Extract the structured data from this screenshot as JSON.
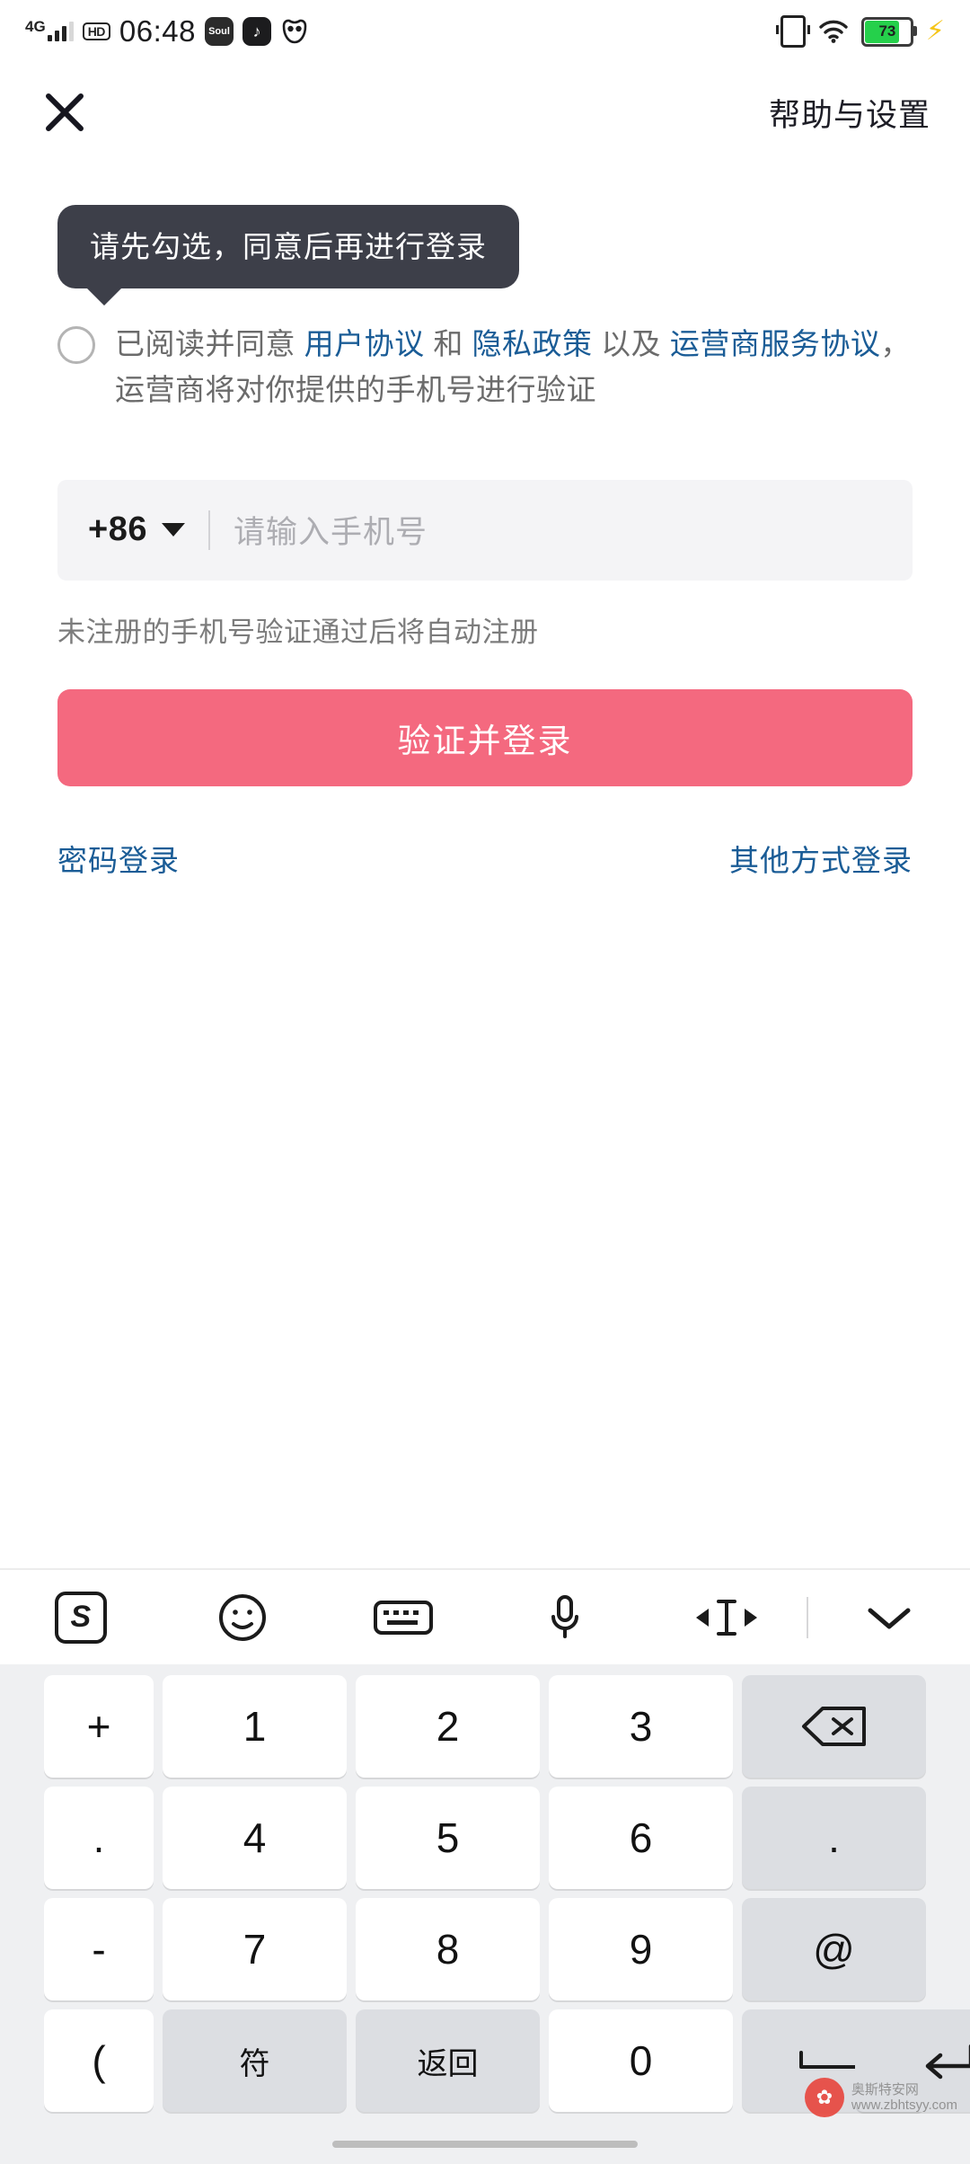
{
  "status_bar": {
    "network": "4G",
    "hd": "HD",
    "time": "06:48",
    "app_icons": [
      "Soul",
      "music-note",
      "owl"
    ],
    "battery_level": "73",
    "battery_color": "#25d04b"
  },
  "header": {
    "close_icon": "close-icon",
    "help_settings": "帮助与设置"
  },
  "tooltip": {
    "message": "请先勾选，同意后再进行登录"
  },
  "agreement": {
    "checked": false,
    "prefix": "已阅读并同意 ",
    "link_user": "用户协议",
    "conj1": " 和 ",
    "link_privacy": "隐私政策",
    "conj2": " 以及 ",
    "link_operator": "运营商服务协议",
    "suffix": "，运营商将对你提供的手机号进行验证"
  },
  "phone_input": {
    "country_code": "+86",
    "placeholder": "请输入手机号",
    "value": ""
  },
  "hint": "未注册的手机号验证通过后将自动注册",
  "login_button": {
    "label": "验证并登录",
    "color": "#f4697f"
  },
  "bottom_links": {
    "password_login": "密码登录",
    "other_login": "其他方式登录",
    "color": "#1a5c96"
  },
  "keyboard": {
    "toolbar": [
      {
        "name": "sogou-logo-icon",
        "glyph": "S"
      },
      {
        "name": "emoji-icon",
        "glyph": "☺"
      },
      {
        "name": "keyboard-switch-icon",
        "glyph": "⌨"
      },
      {
        "name": "microphone-icon",
        "glyph": "🎤"
      },
      {
        "name": "cursor-move-icon",
        "glyph": "◄I►"
      },
      {
        "name": "collapse-keyboard-icon",
        "glyph": "⌄"
      }
    ],
    "rows": [
      [
        {
          "label": "+",
          "type": "normal",
          "name": "key-plus"
        },
        {
          "label": "1",
          "type": "normal",
          "name": "key-1"
        },
        {
          "label": "2",
          "type": "normal",
          "name": "key-2"
        },
        {
          "label": "3",
          "type": "normal",
          "name": "key-3"
        },
        {
          "label": "⌫",
          "type": "fn",
          "name": "key-backspace"
        }
      ],
      [
        {
          "label": ".",
          "type": "normal",
          "name": "key-dot-left"
        },
        {
          "label": "4",
          "type": "normal",
          "name": "key-4"
        },
        {
          "label": "5",
          "type": "normal",
          "name": "key-5"
        },
        {
          "label": "6",
          "type": "normal",
          "name": "key-6"
        },
        {
          "label": ".",
          "type": "fn",
          "name": "key-period"
        }
      ],
      [
        {
          "label": "-",
          "type": "normal",
          "name": "key-minus"
        },
        {
          "label": "7",
          "type": "normal",
          "name": "key-7"
        },
        {
          "label": "8",
          "type": "normal",
          "name": "key-8"
        },
        {
          "label": "9",
          "type": "normal",
          "name": "key-9"
        },
        {
          "label": "@",
          "type": "fn",
          "name": "key-at"
        }
      ],
      [
        {
          "label": "(",
          "type": "normal",
          "name": "key-paren"
        },
        {
          "label": "符",
          "type": "fn",
          "name": "key-symbols"
        },
        {
          "label": "返回",
          "type": "fn",
          "name": "key-return-label"
        },
        {
          "label": "0",
          "type": "normal",
          "name": "key-0"
        },
        {
          "label": "␣",
          "type": "fn",
          "name": "key-space"
        },
        {
          "label": "↵",
          "type": "fn",
          "name": "key-enter"
        }
      ]
    ]
  },
  "watermark": {
    "line1": "奥斯特安网",
    "line2": "www.zbhtsyy.com"
  }
}
